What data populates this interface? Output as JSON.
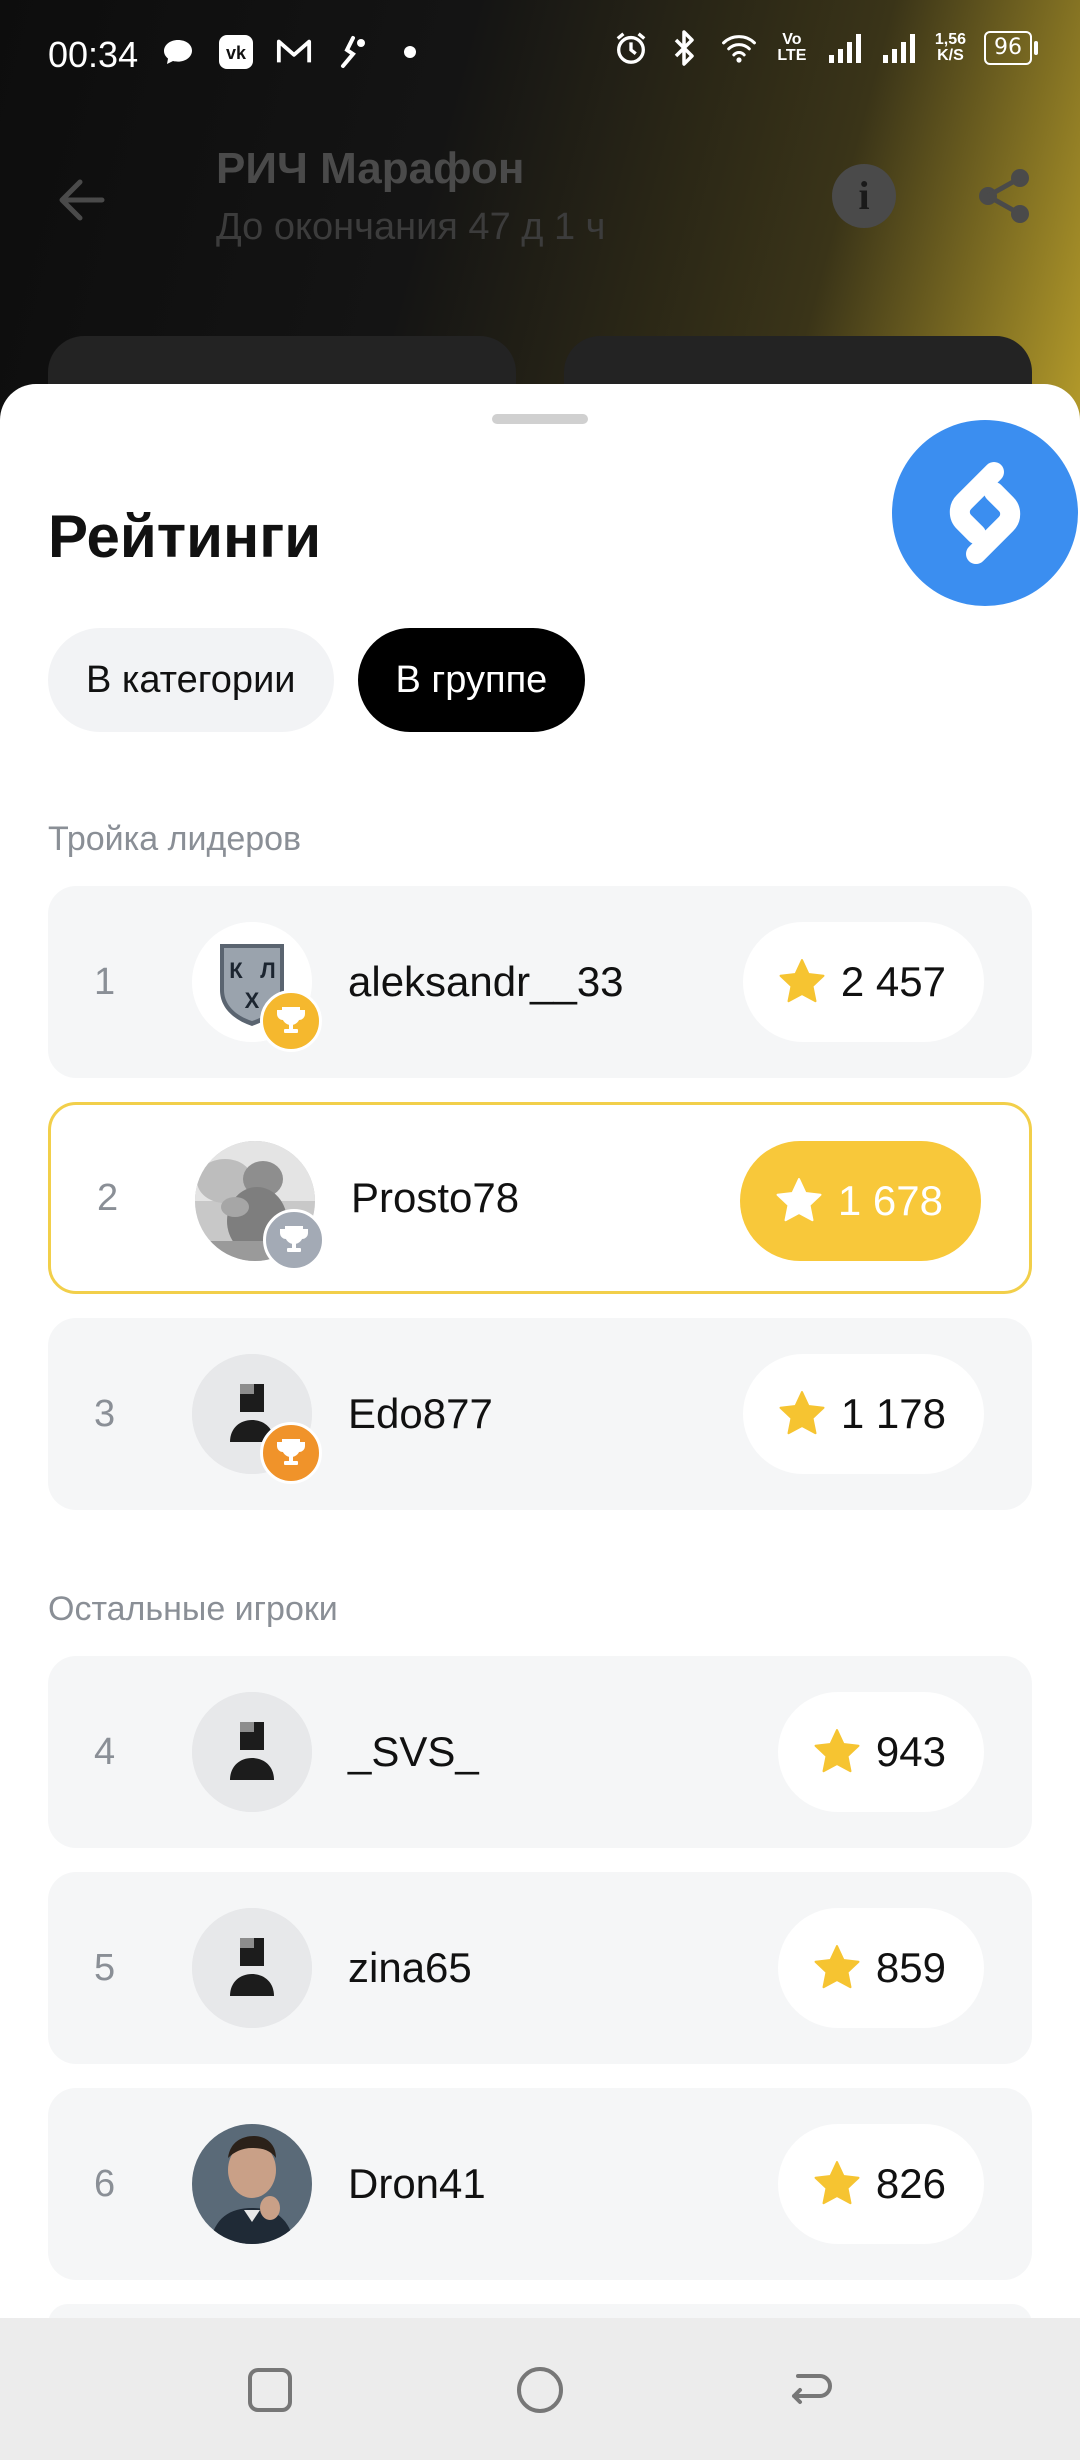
{
  "status_bar": {
    "time": "00:34",
    "net_speed_value": "1,56",
    "net_speed_unit": "K/S",
    "volte": "Vo LTE",
    "battery": "96"
  },
  "app": {
    "title": "РИЧ Марафон",
    "subtitle": "До окончания 47 д 1 ч"
  },
  "sheet": {
    "title": "Рейтинги",
    "tabs": [
      {
        "label": "В категории",
        "active": false
      },
      {
        "label": "В группе",
        "active": true
      }
    ],
    "leaders_label": "Тройка лидеров",
    "others_label": "Остальные игроки",
    "leaders": [
      {
        "rank": "1",
        "name": "aleksandr__33",
        "score": "2 457",
        "medal": "gold",
        "avatar": "khl-logo-avatar"
      },
      {
        "rank": "2",
        "name": "Prosto78",
        "score": "1 678",
        "medal": "silver",
        "avatar": "statue-photo-avatar",
        "is_current_user": true
      },
      {
        "rank": "3",
        "name": "Edo877",
        "score": "1 178",
        "medal": "bronze",
        "avatar": "default-person-avatar"
      }
    ],
    "others": [
      {
        "rank": "4",
        "name": "_SVS_",
        "score": "943",
        "avatar": "default-person-avatar"
      },
      {
        "rank": "5",
        "name": "zina65",
        "score": "859",
        "avatar": "default-person-avatar"
      },
      {
        "rank": "6",
        "name": "Dron41",
        "score": "826",
        "avatar": "man-photo-avatar"
      }
    ]
  },
  "colors": {
    "accent_gold": "#f8c83a",
    "star": "#f6c431",
    "shazam_blue": "#3b8ef0"
  }
}
